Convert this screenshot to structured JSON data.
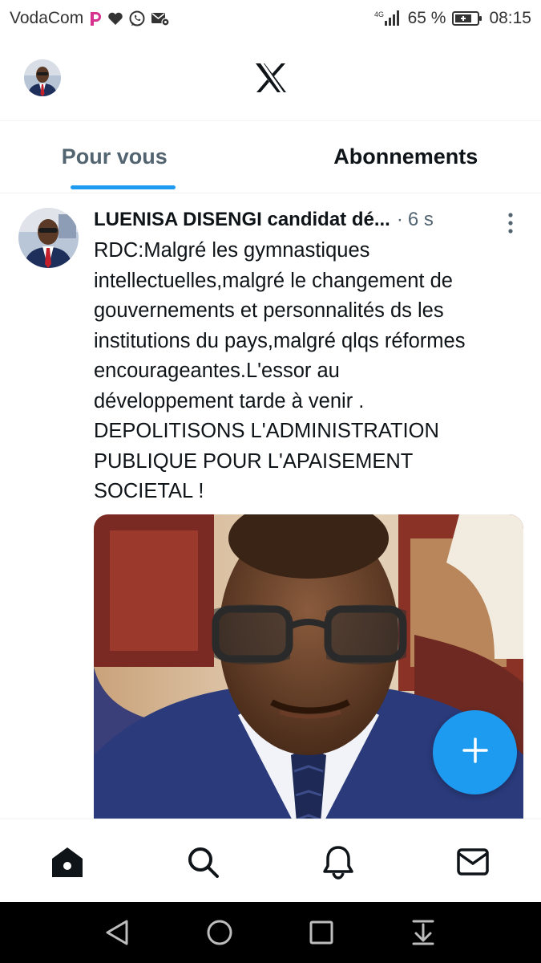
{
  "status_bar": {
    "carrier": "VodaCom",
    "network": "4G",
    "battery": "65 %",
    "time": "08:15",
    "icons": [
      "p-app-icon",
      "heart-icon",
      "whatsapp-icon",
      "message-settings-icon",
      "signal-icon",
      "battery-charging-icon"
    ]
  },
  "header": {
    "logo": "x-logo-icon"
  },
  "tabs": [
    {
      "label": "Pour vous",
      "active": true
    },
    {
      "label": "Abonnements",
      "active": false
    }
  ],
  "tweet": {
    "author": "LUENISA DISENGI candidat dé...",
    "separator": "·",
    "time": "6 s",
    "text_lines": [
      "RDC:Malgré les gymnastiques",
      "intellectuelles,malgré le changement de",
      "gouvernements et personnalités ds les",
      "institutions du pays,malgré qlqs réformes",
      "encourageantes.L'essor au",
      "développement tarde à venir .",
      "DEPOLITISONS L'ADMINISTRATION",
      "PUBLIQUE POUR L'APAISEMENT",
      "SOCIETAL !"
    ]
  },
  "fab": {
    "icon": "plus-icon"
  },
  "bottom_nav": [
    "home-icon",
    "search-icon",
    "notifications-bell-icon",
    "messages-envelope-icon"
  ],
  "system_nav": [
    "back-icon",
    "home-circle-icon",
    "recents-icon",
    "notification-pulldown-icon"
  ],
  "colors": {
    "accent": "#1d9bf0",
    "text_primary": "#0f1419",
    "text_secondary": "#536471",
    "divider": "#eff3f4"
  }
}
